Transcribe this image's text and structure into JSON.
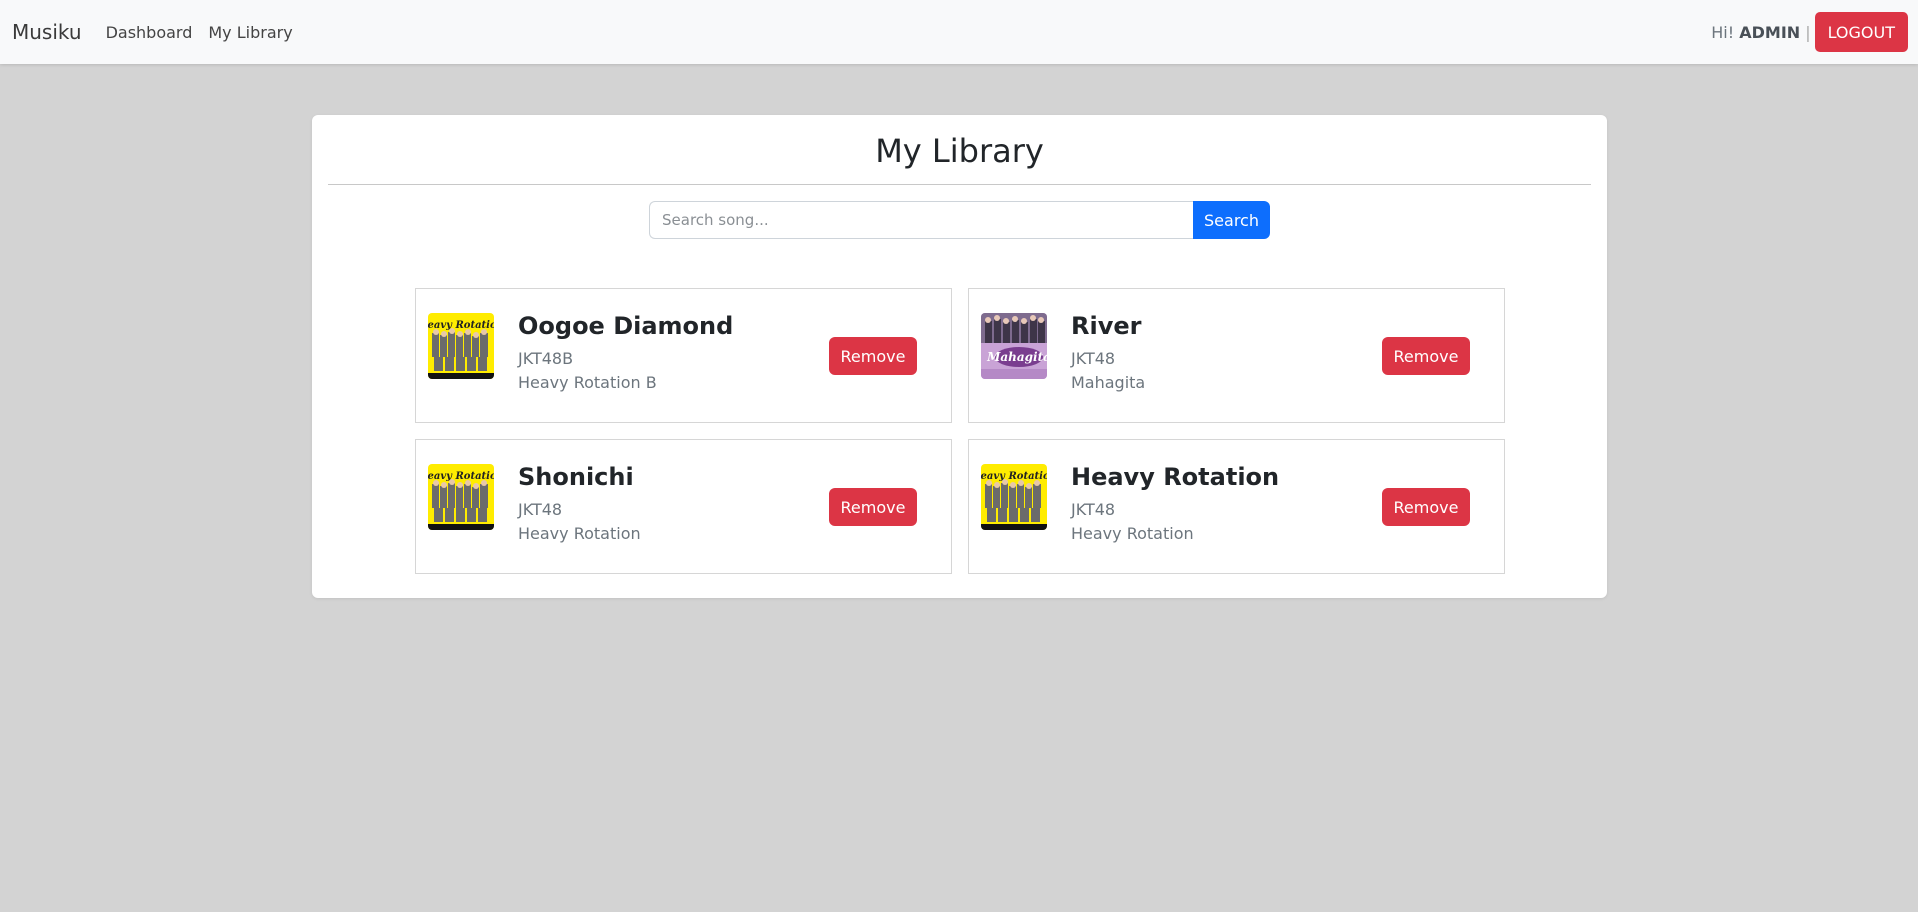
{
  "navbar": {
    "brand": "Musiku",
    "links": [
      "Dashboard",
      "My Library"
    ],
    "greeting_prefix": "Hi!",
    "username": "ADMIN",
    "separator": "|",
    "logout_label": "LOGOUT"
  },
  "library": {
    "title": "My Library",
    "search": {
      "placeholder": "Search song...",
      "button_label": "Search"
    },
    "remove_label": "Remove",
    "songs": [
      {
        "title": "Oogoe Diamond",
        "artist": "JKT48B",
        "album": "Heavy Rotation B",
        "cover": "heavy-rotation-cover"
      },
      {
        "title": "River",
        "artist": "JKT48",
        "album": "Mahagita",
        "cover": "mahagita-cover"
      },
      {
        "title": "Shonichi",
        "artist": "JKT48",
        "album": "Heavy Rotation",
        "cover": "heavy-rotation-cover"
      },
      {
        "title": "Heavy Rotation",
        "artist": "JKT48",
        "album": "Heavy Rotation",
        "cover": "heavy-rotation-cover"
      }
    ]
  },
  "colors": {
    "page_background": "#d3d3d3",
    "navbar_background": "#f8f9fa",
    "danger": "#dc3545",
    "primary": "#0d6efd"
  }
}
